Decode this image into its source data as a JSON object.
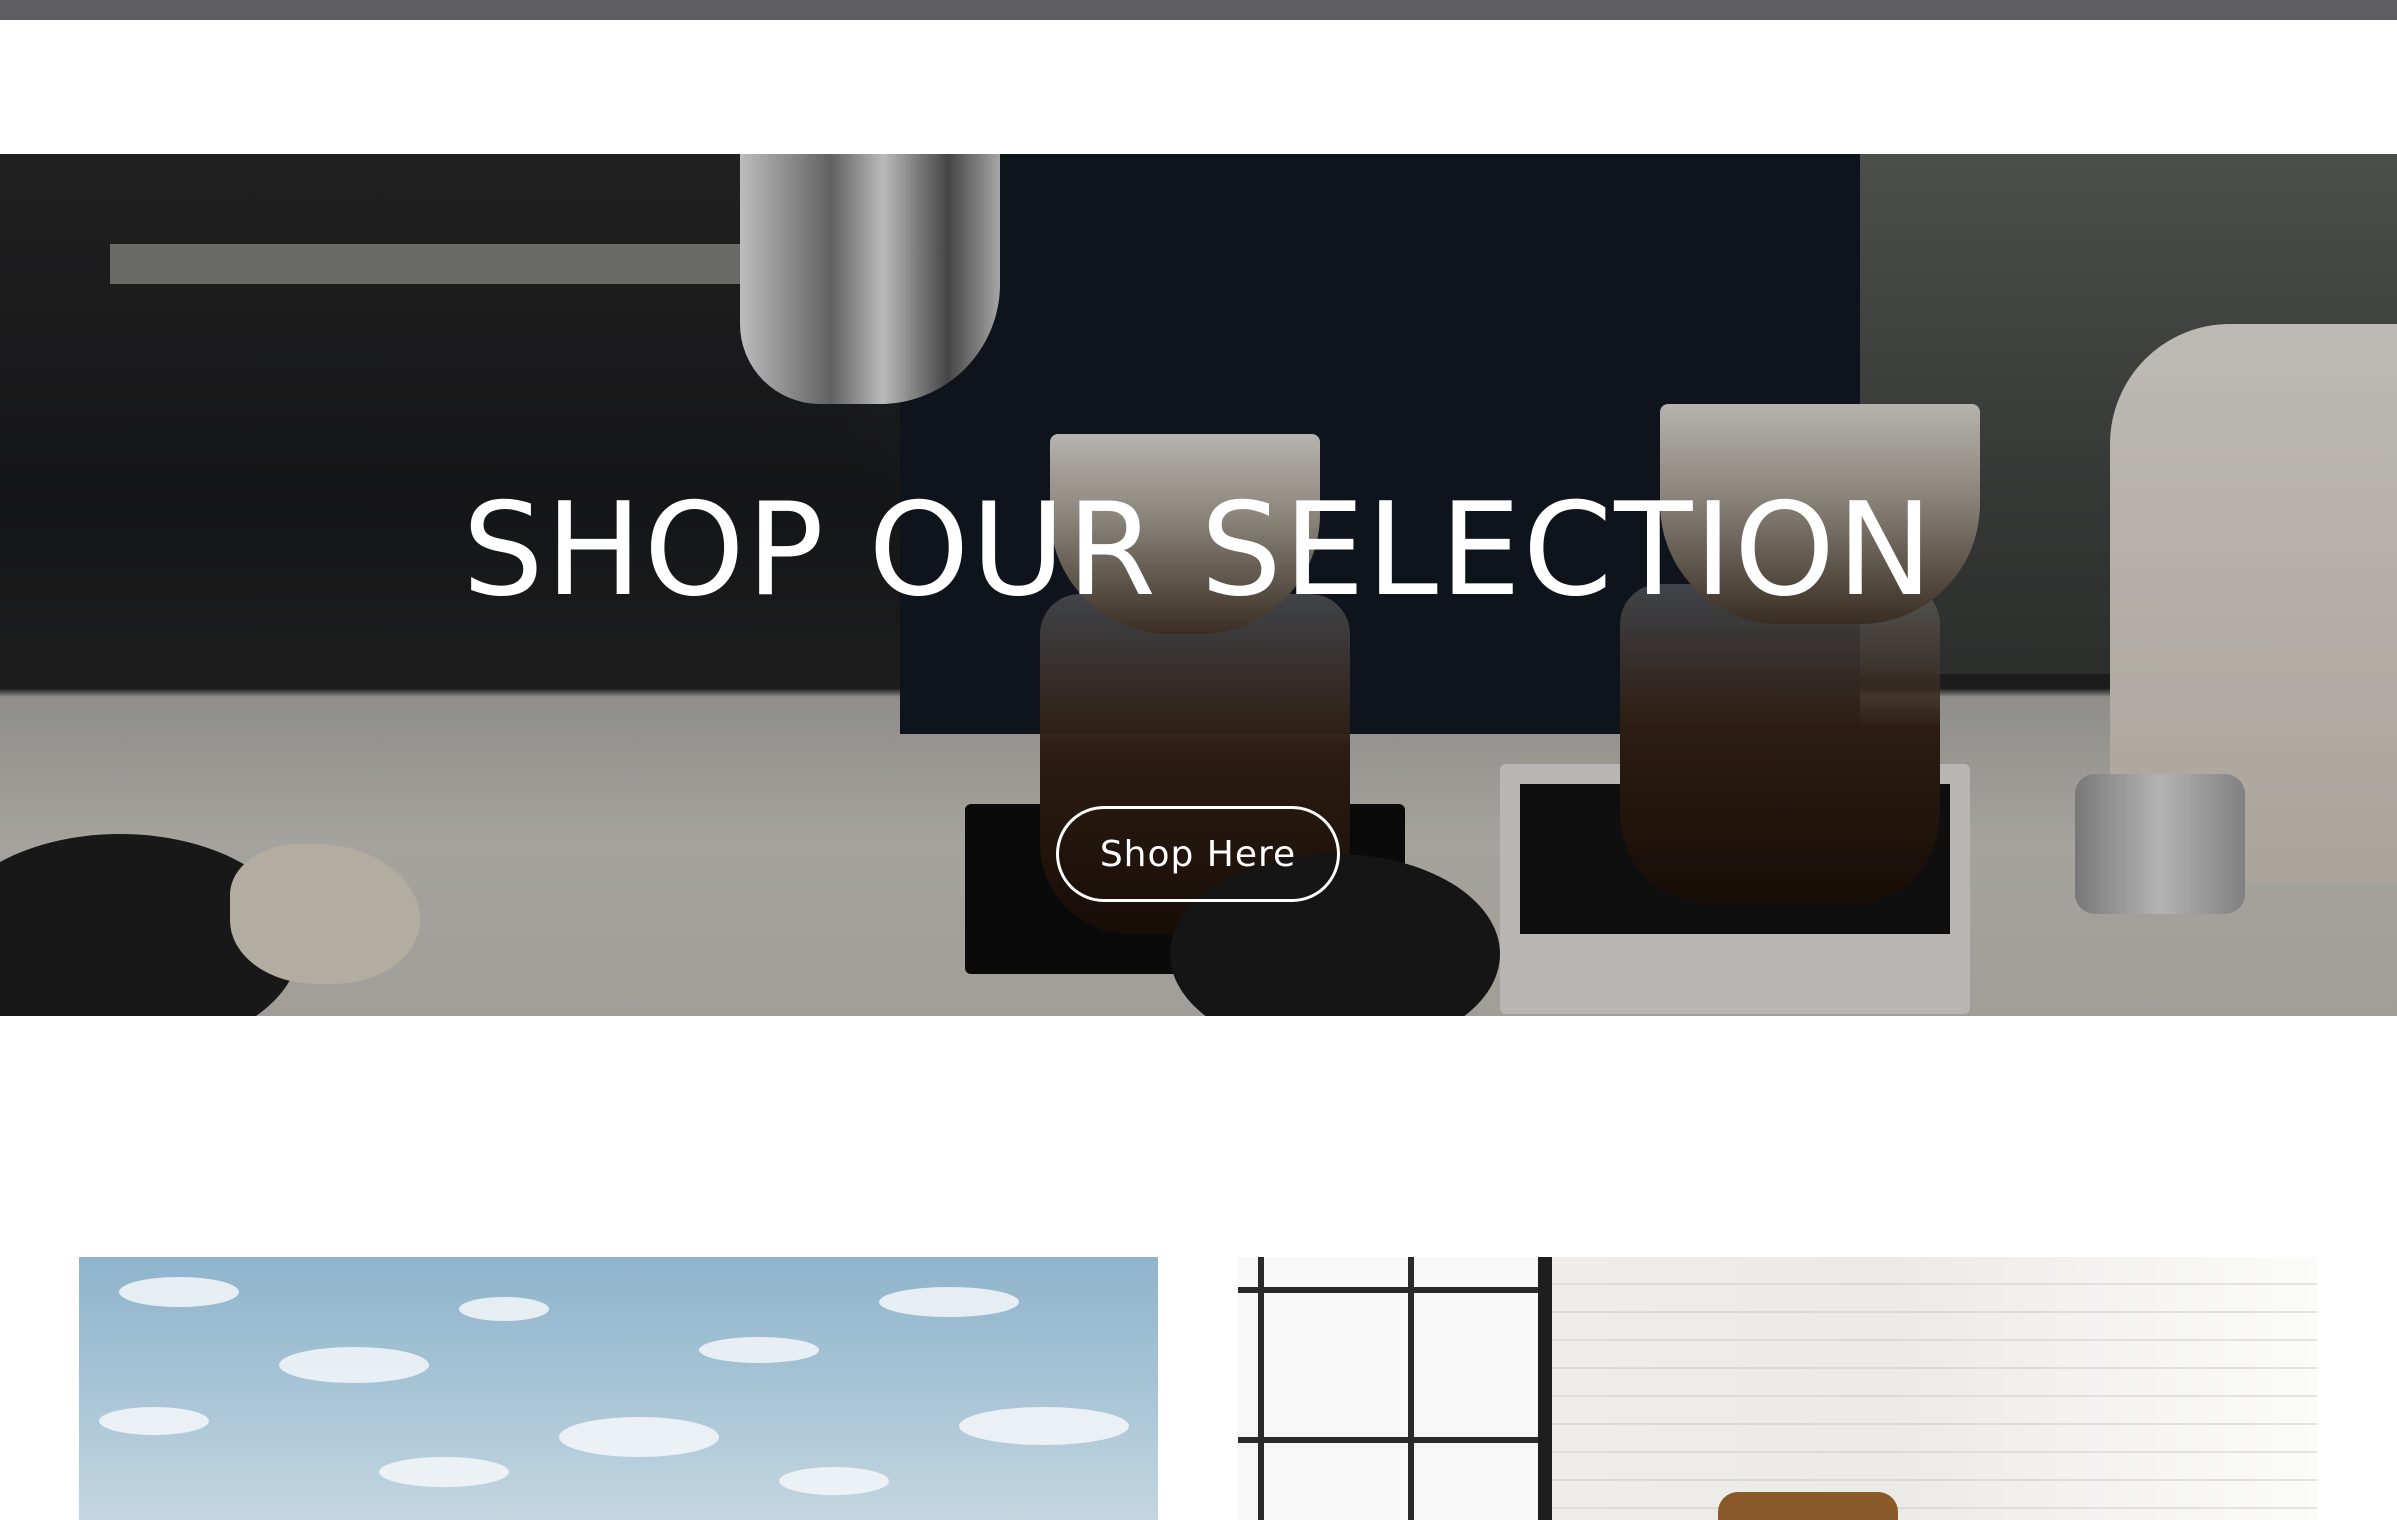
{
  "hero": {
    "title": "SHOP OUR SELECTION",
    "button_label": "Shop Here"
  }
}
